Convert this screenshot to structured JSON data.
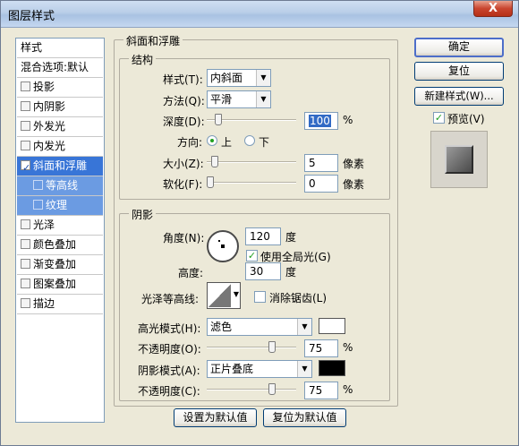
{
  "window": {
    "title": "图层样式",
    "close_symbol": "X"
  },
  "style_list": {
    "header": "样式",
    "blend_options": "混合选项:默认",
    "items": [
      {
        "label": "投影",
        "checked": false
      },
      {
        "label": "内阴影",
        "checked": false
      },
      {
        "label": "外发光",
        "checked": false
      },
      {
        "label": "内发光",
        "checked": false
      },
      {
        "label": "斜面和浮雕",
        "checked": true
      },
      {
        "label": "等高线",
        "checked": false
      },
      {
        "label": "纹理",
        "checked": false
      },
      {
        "label": "光泽",
        "checked": false
      },
      {
        "label": "颜色叠加",
        "checked": false
      },
      {
        "label": "渐变叠加",
        "checked": false
      },
      {
        "label": "图案叠加",
        "checked": false
      },
      {
        "label": "描边",
        "checked": false
      }
    ]
  },
  "bevel": {
    "group_title": "斜面和浮雕",
    "structure": {
      "title": "结构",
      "style_label": "样式(T):",
      "style_value": "内斜面",
      "technique_label": "方法(Q):",
      "technique_value": "平滑",
      "depth_label": "深度(D):",
      "depth_value": "100",
      "depth_unit": "%",
      "depth_slider": 0.1,
      "direction_label": "方向:",
      "dir_up": "上",
      "dir_down": "下",
      "direction_selected": "上",
      "size_label": "大小(Z):",
      "size_value": "5",
      "size_unit": "像素",
      "size_slider": 0.05,
      "soften_label": "软化(F):",
      "soften_value": "0",
      "soften_unit": "像素",
      "soften_slider": 0.0
    },
    "shading": {
      "title": "阴影",
      "angle_label": "角度(N):",
      "angle_value": "120",
      "angle_unit": "度",
      "global_light_label": "使用全局光(G)",
      "global_light_checked": true,
      "altitude_label": "高度:",
      "altitude_value": "30",
      "altitude_unit": "度",
      "gloss_label": "光泽等高线:",
      "antialias_label": "消除锯齿(L)",
      "antialias_checked": false,
      "highlight_label": "高光模式(H):",
      "highlight_mode": "滤色",
      "highlight_color": "#ffffff",
      "highlight_opacity_label": "不透明度(O):",
      "highlight_opacity": "75",
      "highlight_opacity_slider": 0.75,
      "shadow_label": "阴影模式(A):",
      "shadow_mode": "正片叠底",
      "shadow_color": "#000000",
      "shadow_opacity_label": "不透明度(C):",
      "shadow_opacity": "75",
      "shadow_opacity_slider": 0.75,
      "percent": "%"
    }
  },
  "footer": {
    "make_default": "设置为默认值",
    "reset_default": "复位为默认值"
  },
  "buttons": {
    "ok": "确定",
    "reset": "复位",
    "new_style": "新建样式(W)...",
    "preview_label": "预览(V)",
    "preview_checked": true
  }
}
